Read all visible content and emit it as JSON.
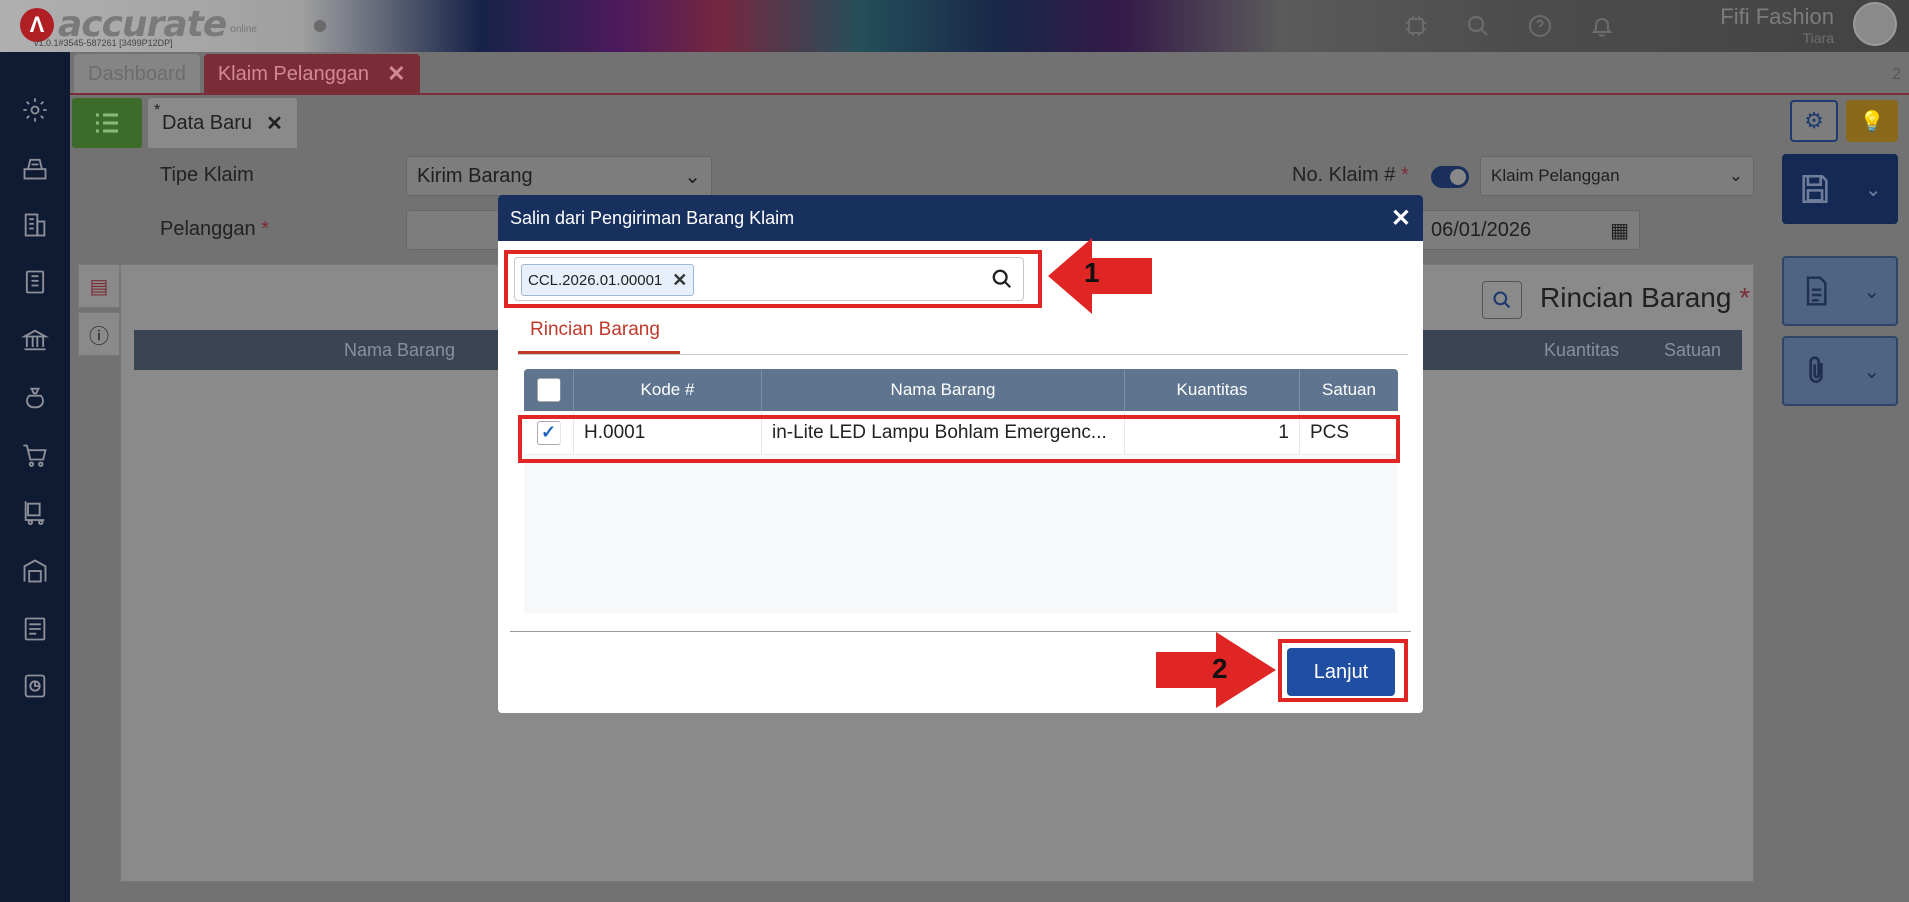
{
  "header": {
    "logo_text": "accurate",
    "logo_cloud": "online",
    "version": "v1.0.1#3545-587261 [3499P12DP]",
    "company": "Fifi Fashion",
    "user": "Tiara",
    "icons": [
      "ai-icon",
      "search-icon",
      "help-icon",
      "bell-icon"
    ]
  },
  "sidebar": {
    "icons": [
      "settings-icon",
      "cashier-icon",
      "building-icon",
      "ledger-icon",
      "bank-icon",
      "money-bag-icon",
      "cart-icon",
      "delivery-icon",
      "warehouse-icon",
      "tax-icon",
      "report-icon"
    ]
  },
  "tabs": {
    "dashboard": "Dashboard",
    "active": "Klaim Pelanggan",
    "count": "2"
  },
  "subtab": {
    "star": "*",
    "label": "Data Baru"
  },
  "form": {
    "tipe_klaim_label": "Tipe Klaim",
    "tipe_klaim_value": "Kirim Barang",
    "pelanggan_label": "Pelanggan",
    "no_klaim_label": "No. Klaim #",
    "no_klaim_select": "Klaim Pelanggan",
    "date_value": "06/01/2026",
    "required_mark": "*"
  },
  "panel": {
    "title": "Rincian Barang",
    "col_nama": "Nama Barang",
    "col_kuantitas": "Kuantitas",
    "col_satuan": "Satuan"
  },
  "modal": {
    "title": "Salin dari Pengiriman Barang Klaim",
    "chip": "CCL.2026.01.00001",
    "tab": "Rincian Barang",
    "columns": [
      "Kode #",
      "Nama Barang",
      "Kuantitas",
      "Satuan"
    ],
    "row": {
      "checked": true,
      "kode": "H.0001",
      "nama": "in-Lite LED Lampu Bohlam Emergenc...",
      "kuantitas": "1",
      "satuan": "PCS"
    },
    "button": "Lanjut"
  },
  "annotations": {
    "step1": "1",
    "step2": "2",
    "color": "#e02525"
  }
}
